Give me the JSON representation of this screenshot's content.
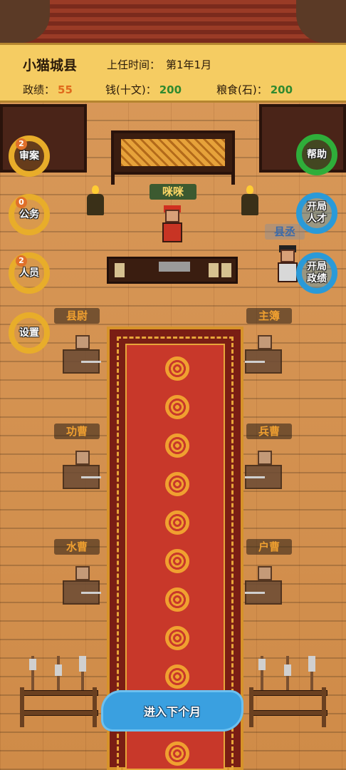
{
  "header": {
    "county_name": "小猫城县",
    "appointed_label": "上任时间：",
    "appointed_value": "第1年1月",
    "merit_label": "政绩：",
    "merit_value": "55",
    "money_label": "钱(十文)：",
    "money_value": "200",
    "grain_label": "粮食(石)：",
    "grain_value": "200"
  },
  "left_menu": [
    {
      "label": "审案",
      "badge": "2"
    },
    {
      "label": "公务",
      "badge": "0"
    },
    {
      "label": "人员",
      "badge": "2"
    },
    {
      "label": "设置",
      "badge": ""
    }
  ],
  "right_menu": [
    {
      "label": "帮助"
    },
    {
      "label": "开局\n人才"
    },
    {
      "label": "开局\n政绩"
    }
  ],
  "characters": {
    "magistrate": "咪咪",
    "deputy": "县丞"
  },
  "officials": {
    "left_1": "县尉",
    "right_1": "主簿",
    "left_2": "功曹",
    "right_2": "兵曹",
    "left_3": "水曹",
    "right_3": "户曹"
  },
  "next_month_label": "进入下个月",
  "colors": {
    "panel": "#f5cc62",
    "merit": "#e06a1c",
    "resource": "#2f8a2f",
    "carpet": "#c8382a",
    "accent_yellow": "#e8ad2a",
    "accent_green": "#2fae3a",
    "accent_blue": "#2a9ad8"
  }
}
